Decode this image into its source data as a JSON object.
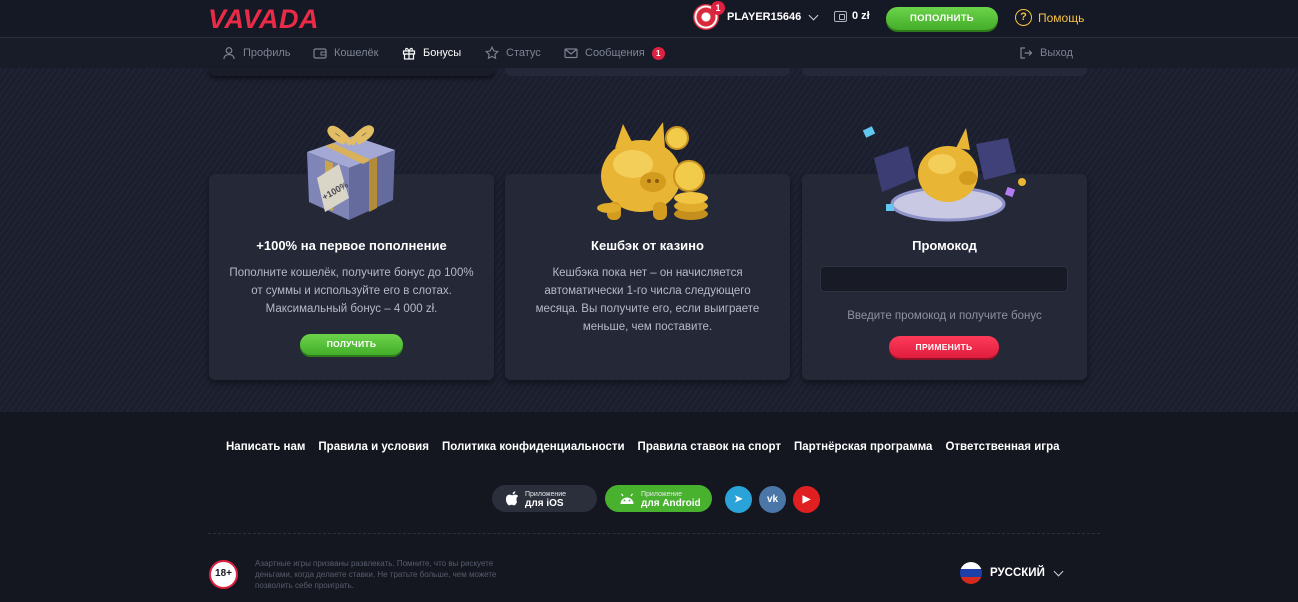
{
  "header": {
    "logo": "VAVADA",
    "notification_count": "1",
    "username": "PLAYER15646",
    "balance": "0 zł",
    "deposit_label": "ПОПОЛНИТЬ",
    "help_label": "Помощь"
  },
  "nav": {
    "tabs": [
      {
        "label": "Профиль",
        "icon": "user-icon"
      },
      {
        "label": "Кошелёк",
        "icon": "wallet-icon"
      },
      {
        "label": "Бонусы",
        "icon": "gift-icon",
        "active": true
      },
      {
        "label": "Статус",
        "icon": "star-icon"
      },
      {
        "label": "Сообщения",
        "icon": "mail-icon",
        "badge": "1"
      }
    ],
    "logout_label": "Выход"
  },
  "bonuses": {
    "deposit": {
      "title": "+100% на первое пополнение",
      "description": "Пополните кошелёк, получите бонус до 100% от суммы и используйте его в слотах. Максимальный бонус – 4 000 zł.",
      "button": "ПОЛУЧИТЬ",
      "tag_text": "+100%"
    },
    "cashback": {
      "title": "Кешбэк от казино",
      "description": "Кешбэка пока нет – он начисляется автоматически 1-го числа следующего месяца. Вы получите его, если выиграете меньше, чем поставите."
    },
    "promo": {
      "title": "Промокод",
      "input_value": "",
      "hint": "Введите промокод и получите бонус",
      "button": "ПРИМЕНИТЬ"
    }
  },
  "footer": {
    "links": [
      "Написать нам",
      "Правила и условия",
      "Политика конфиденциальности",
      "Правила ставок на спорт",
      "Партнёрская программа",
      "Ответственная игра"
    ],
    "apps": [
      {
        "small": "Приложение",
        "big": "для iOS",
        "icon": "apple-icon"
      },
      {
        "small": "Приложение",
        "big": "для Android",
        "icon": "android-icon"
      }
    ],
    "social": [
      {
        "name": "telegram-icon",
        "glyph": "➤",
        "color": "#2aa3d9"
      },
      {
        "name": "vk-icon",
        "glyph": "vk",
        "color": "#4a76a8"
      },
      {
        "name": "youtube-icon",
        "glyph": "▶",
        "color": "#e02020"
      }
    ],
    "age_badge": "18+",
    "disclaimer": "Азартные игры призваны развлекать. Помните, что вы рискуете деньгами, когда делаете ставки. Не тратьте больше, чем можете позволить себе проиграть.",
    "language": "РУССКИЙ"
  },
  "colors": {
    "brand_red": "#e92b47",
    "green_button": "#4cb630",
    "red_button": "#f0284a",
    "help_yellow": "#f6c343",
    "card_bg": "#242837"
  }
}
